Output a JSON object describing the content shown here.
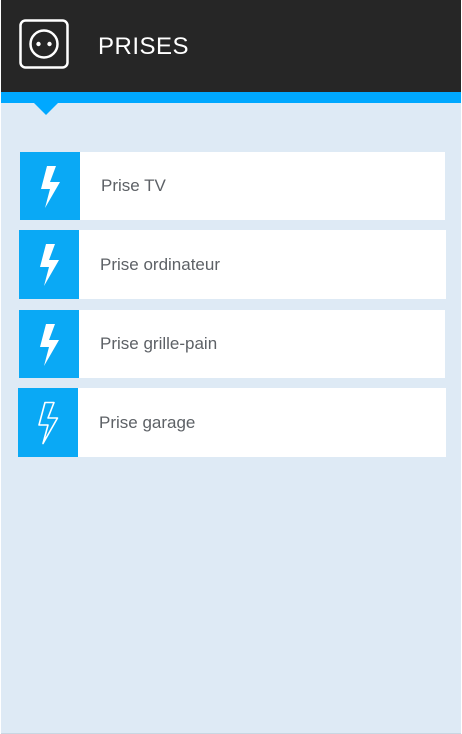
{
  "header": {
    "title": "PRISES",
    "icon": "power-socket-icon",
    "background": "#262626"
  },
  "accent_color": "#00a8ff",
  "outlets": [
    {
      "label": "Prise TV",
      "icon": "lightning-bolt-icon",
      "style": "filled"
    },
    {
      "label": "Prise ordinateur",
      "icon": "lightning-bolt-icon",
      "style": "filled"
    },
    {
      "label": "Prise grille-pain",
      "icon": "lightning-bolt-icon",
      "style": "filled"
    },
    {
      "label": "Prise garage",
      "icon": "lightning-bolt-outline-icon",
      "style": "outline"
    }
  ]
}
